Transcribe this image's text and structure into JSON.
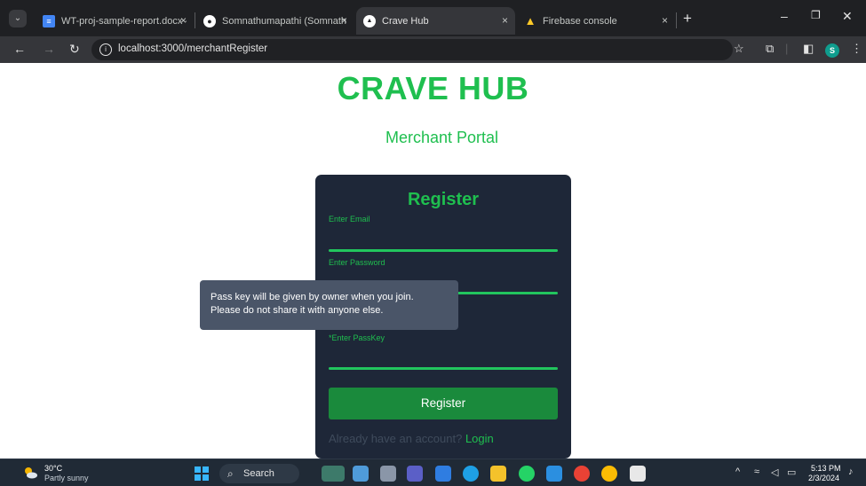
{
  "browser": {
    "tabs": [
      {
        "title": "WT-proj-sample-report.docx - ",
        "icon": "docs-icon",
        "close": "×"
      },
      {
        "title": "Somnathumapathi (Somnath U)",
        "icon": "github-icon",
        "close": "×"
      },
      {
        "title": "Crave Hub",
        "icon": "react-app-icon",
        "close": "×",
        "active": true
      },
      {
        "title": "Firebase console",
        "icon": "firebase-icon",
        "close": "×"
      }
    ],
    "new_tab": "+",
    "url": "localhost:3000/merchantRegister"
  },
  "page": {
    "brand": "CRAVE HUB",
    "subtitle": "Merchant Portal",
    "form": {
      "title": "Register",
      "fields": [
        {
          "label": "Enter Email"
        },
        {
          "label": "Enter Password"
        },
        {
          "label": "*Enter PassKey"
        }
      ],
      "submit_label": "Register",
      "login_prompt": "Already have an account?",
      "login_link": "Login"
    },
    "tooltip": {
      "line1": "Pass key will be given by owner when you join.",
      "line2": "Please do not share it with anyone else."
    }
  },
  "taskbar": {
    "weather": {
      "temp": "30°C",
      "desc": "Partly sunny"
    },
    "search_label": "Search",
    "time": "5:13 PM",
    "date": "2/3/2024"
  },
  "colors": {
    "accent_green": "#1fbf4f",
    "card_bg": "#1e2738",
    "button_green": "#1a8a3c",
    "tooltip_bg": "#4a5568"
  }
}
